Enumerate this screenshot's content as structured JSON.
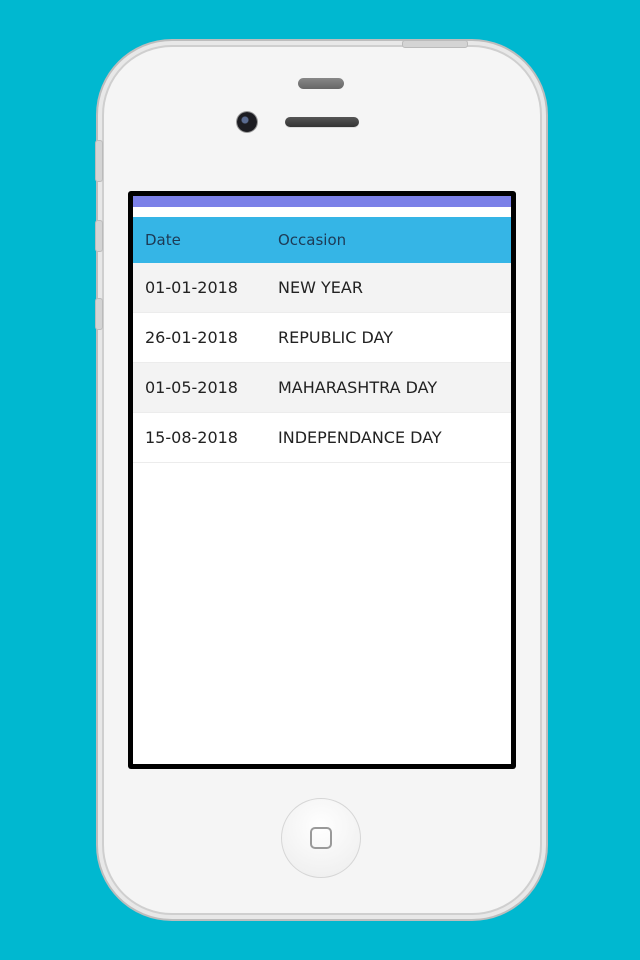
{
  "table": {
    "headers": {
      "date": "Date",
      "occasion": "Occasion"
    },
    "rows": [
      {
        "date": "01-01-2018",
        "occasion": "NEW YEAR"
      },
      {
        "date": "26-01-2018",
        "occasion": "REPUBLIC DAY"
      },
      {
        "date": "01-05-2018",
        "occasion": "MAHARASHTRA DAY"
      },
      {
        "date": "15-08-2018",
        "occasion": "INDEPENDANCE DAY"
      }
    ]
  },
  "colors": {
    "background": "#00B8D0",
    "status_bar": "#7B80E8",
    "header": "#35B5E6"
  }
}
